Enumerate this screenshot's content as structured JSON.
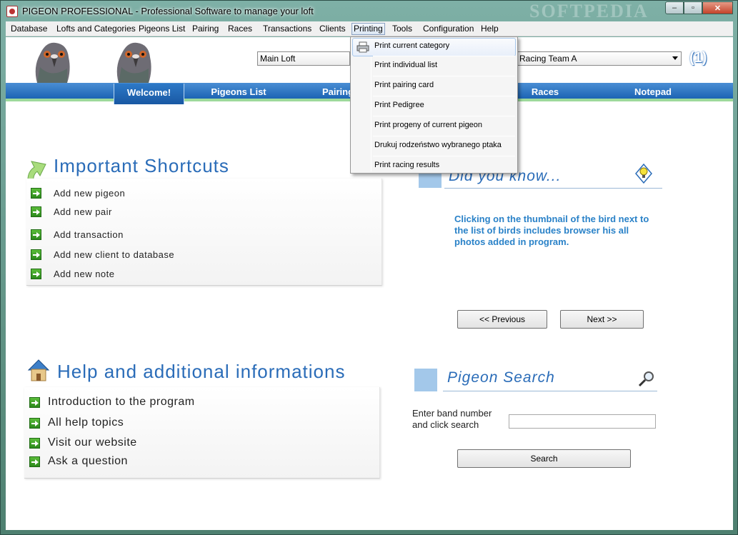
{
  "window": {
    "title": "PIGEON PROFESSIONAL - Professional Software to manage your loft",
    "watermark": "SOFTPEDIA",
    "minimize_label": "–",
    "maximize_label": "▫",
    "close_label": "✕"
  },
  "menubar": {
    "items": [
      "Database",
      "Lofts and Categories",
      "Pigeons List",
      "Pairing",
      "Races",
      "Transactions",
      "Clients",
      "Printing",
      "Tools",
      "Configuration",
      "Help"
    ]
  },
  "header": {
    "loft": "Main Loft",
    "team": "Racing Team A",
    "counter": "(1)"
  },
  "nav": {
    "tabs": [
      "Welcome!",
      "Pigeons List",
      "Pairing",
      "Races",
      "Notepad"
    ]
  },
  "shortcuts": {
    "title": "Important Shortcuts",
    "items": [
      "Add new pigeon",
      "Add new pair",
      "Add transaction",
      "Add new client to database",
      "Add new note"
    ]
  },
  "help": {
    "title": "Help and additional informations",
    "items": [
      "Introduction to the program",
      "All help topics",
      "Visit our website",
      "Ask a question"
    ]
  },
  "did_you_know": {
    "title": "Did you know...",
    "text": "Clicking on the thumbnail of the bird next to the list of birds includes browser his all photos added in program.",
    "prev_label": "<< Previous",
    "next_label": "Next >>"
  },
  "search": {
    "title": "Pigeon Search",
    "label_line1": "Enter band number",
    "label_line2": "and click search",
    "input_value": "",
    "button_label": "Search"
  },
  "printing_menu": {
    "items": [
      "Print current category",
      "Print individual list",
      "Print pairing card",
      "Print Pedigree",
      "Print progeny of current pigeon",
      "Drukuj rodzeństwo wybranego ptaka",
      "Print racing results"
    ]
  },
  "colors": {
    "accent_blue": "#2a6cb8",
    "nav_blue": "#1c64b4",
    "nav_underline": "#9dd99b"
  }
}
